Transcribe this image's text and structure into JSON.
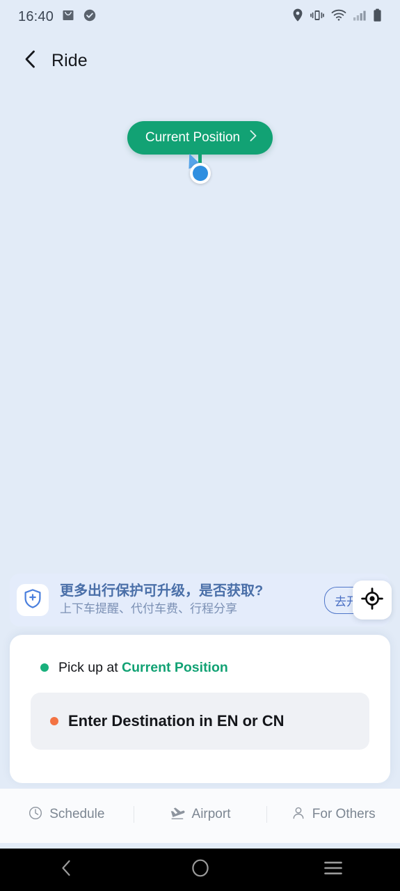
{
  "status_bar": {
    "time": "16:40",
    "left_icons": [
      "mail-icon",
      "check-circle-icon"
    ],
    "right_icons": [
      "location-pin-icon",
      "vibrate-icon",
      "wifi-icon",
      "signal-bars-icon",
      "battery-icon"
    ]
  },
  "header": {
    "back_icon": "chevron-left-icon",
    "title": "Ride"
  },
  "map": {
    "background_color": "#e2ebf7",
    "marker": {
      "pill_label": "Current Position",
      "pill_color": "#12a274",
      "pill_chevron": "chevron-right-icon",
      "dot_color": "#2f8fe0"
    },
    "locate_button": {
      "icon": "gps-crosshair-icon"
    }
  },
  "promo_banner": {
    "icon": "shield-plus-icon",
    "icon_color": "#4a7fdd",
    "title": "更多出行保护可升级，是否获取?",
    "subtitle": "上下车提醒、代付车费、行程分享",
    "button_label": "去开启",
    "background_color": "#e4ecfb"
  },
  "booking_card": {
    "pickup": {
      "dot_color": "#19b07c",
      "prefix": "Pick up at ",
      "location": "Current Position"
    },
    "destination": {
      "dot_color": "#f37343",
      "placeholder": "Enter Destination in EN or CN"
    }
  },
  "bottom_tabs": [
    {
      "label": "Schedule",
      "icon": "clock-icon"
    },
    {
      "label": "Airport",
      "icon": "airplane-takeoff-icon"
    },
    {
      "label": "For Others",
      "icon": "person-icon"
    }
  ],
  "android_nav": {
    "back": "nav-back-icon",
    "home": "nav-home-icon",
    "recents": "nav-recents-icon"
  }
}
